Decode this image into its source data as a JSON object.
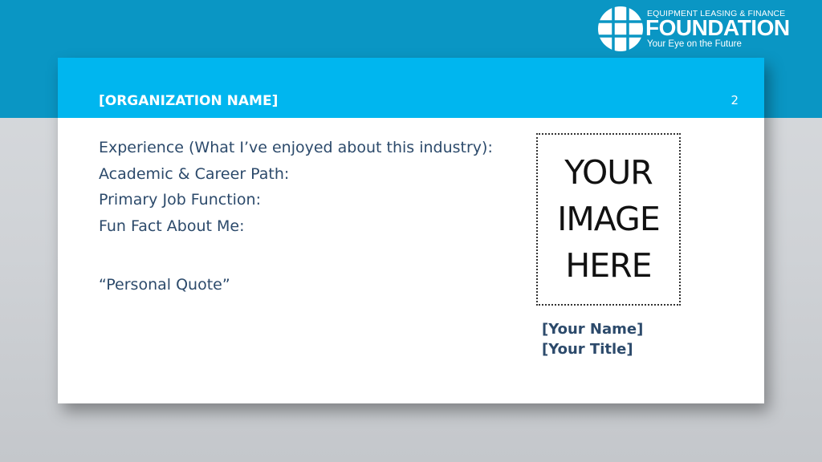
{
  "logo": {
    "top_text": "EQUIPMENT LEASING & FINANCE",
    "main_text": "FOUNDATION",
    "tagline": "Your Eye on the Future"
  },
  "slide": {
    "organization": "[ORGANIZATION NAME]",
    "page_number": "2",
    "fields": [
      "Experience (What I’ve enjoyed about this industry):",
      "Academic & Career Path:",
      "Primary Job Function:",
      "Fun Fact About Me:"
    ],
    "quote": "“Personal Quote”",
    "image_placeholder": [
      "YOUR",
      "IMAGE",
      "HERE"
    ],
    "name": "[Your Name]",
    "title": "[Your Title]"
  },
  "colors": {
    "top_band": "#0a96c4",
    "header": "#00b6ef",
    "text": "#2c4a6b"
  },
  "icons": [
    "globe-logo-icon"
  ]
}
